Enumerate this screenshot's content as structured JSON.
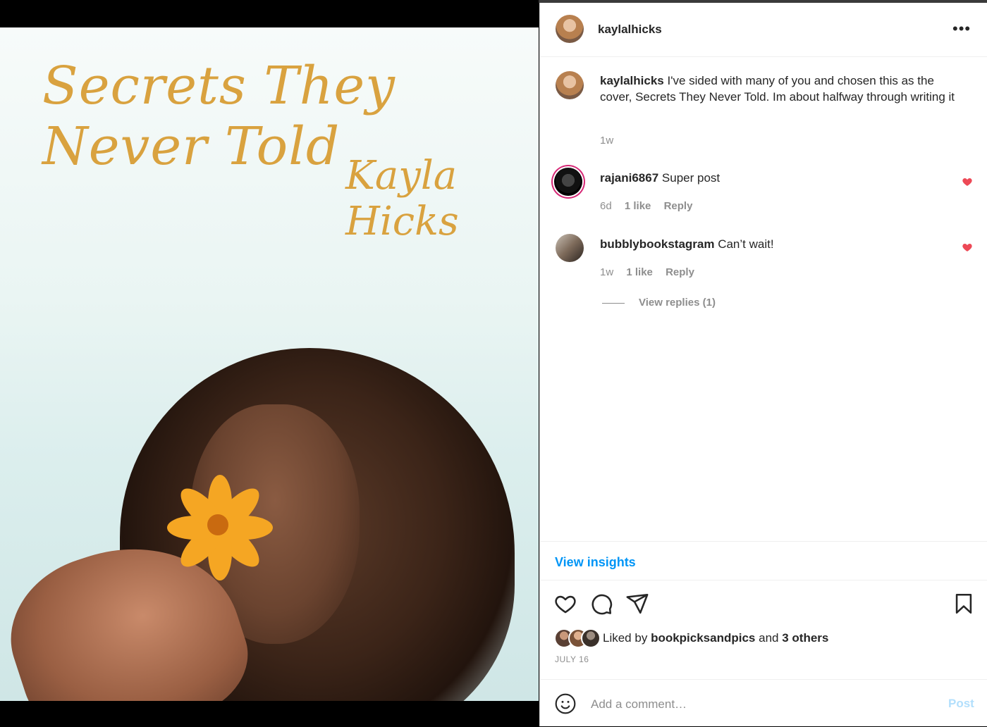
{
  "media": {
    "cover_title": "Secrets They Never Told",
    "cover_author": "Kayla Hicks"
  },
  "post": {
    "author": "kaylalhicks",
    "more_icon": "more-horizontal-icon",
    "caption": {
      "username": "kaylalhicks",
      "text": "I've sided with many of you and chosen this as the cover, Secrets They Never Told. Im about halfway through writing it",
      "time": "1w"
    },
    "comments": [
      {
        "username": "rajani6867",
        "text": "Super post",
        "time": "6d",
        "likes": "1 like",
        "reply": "Reply"
      },
      {
        "username": "bubblybookstagram",
        "text": "Can’t wait!",
        "time": "1w",
        "likes": "1 like",
        "reply": "Reply"
      }
    ],
    "view_replies": "View replies (1)",
    "insights_label": "View insights",
    "liked_by": {
      "prefix": "Liked by",
      "user": "bookpicksandpics",
      "conj": "and",
      "others": "3 others"
    },
    "date": "JULY 16",
    "add_comment_placeholder": "Add a comment…",
    "post_label": "Post"
  },
  "colors": {
    "accent": "#0095f6",
    "heart": "#ed4956",
    "cover_text": "#d9a23f",
    "post_disabled": "#b2dffc"
  }
}
